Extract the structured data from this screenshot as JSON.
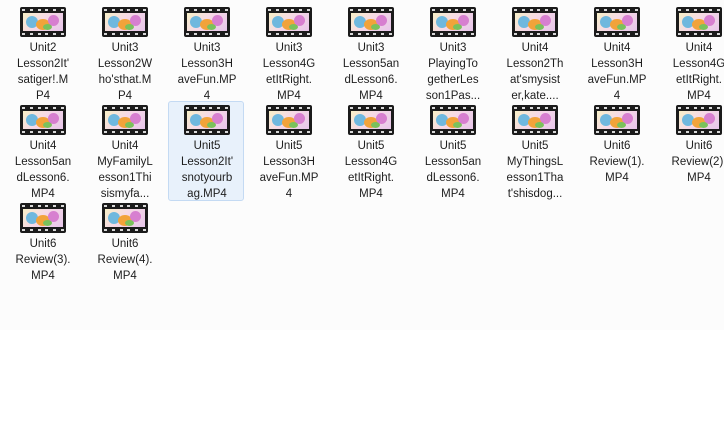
{
  "files": [
    {
      "label": "Unit2\nLesson2It'\nsatiger!.M\nP4",
      "icon": "video-file-icon"
    },
    {
      "label": "Unit3\nLesson2W\nho'sthat.M\nP4",
      "icon": "video-file-icon"
    },
    {
      "label": "Unit3\nLesson3H\naveFun.MP\n4",
      "icon": "video-file-icon"
    },
    {
      "label": "Unit3\nLesson4G\netItRight.\nMP4",
      "icon": "video-file-icon"
    },
    {
      "label": "Unit3\nLesson5an\ndLesson6.\nMP4",
      "icon": "video-file-icon"
    },
    {
      "label": "Unit3\nPlayingTo\ngetherLes\nson1Pas...",
      "icon": "video-file-icon"
    },
    {
      "label": "Unit4\nLesson2Th\nat'smysist\ner,kate....",
      "icon": "video-file-icon"
    },
    {
      "label": "Unit4\nLesson3H\naveFun.MP\n4",
      "icon": "video-file-icon"
    },
    {
      "label": "Unit4\nLesson4G\netItRight.\nMP4",
      "icon": "video-file-icon"
    },
    {
      "label": "Unit4\nLesson5an\ndLesson6.\nMP4",
      "icon": "video-file-icon"
    },
    {
      "label": "Unit4\nMyFamilyL\nesson1Thi\nsismyfa...",
      "icon": "video-file-icon"
    },
    {
      "label": "Unit5\nLesson2It'\nsnotyourb\nag.MP4",
      "icon": "video-file-icon",
      "selected": true
    },
    {
      "label": "Unit5\nLesson3H\naveFun.MP\n4",
      "icon": "video-file-icon"
    },
    {
      "label": "Unit5\nLesson4G\netItRight.\nMP4",
      "icon": "video-file-icon"
    },
    {
      "label": "Unit5\nLesson5an\ndLesson6.\nMP4",
      "icon": "video-file-icon"
    },
    {
      "label": "Unit5\nMyThingsL\nesson1Tha\nt'shisdog...",
      "icon": "video-file-icon"
    },
    {
      "label": "Unit6\nReview(1).\nMP4",
      "icon": "video-file-icon"
    },
    {
      "label": "Unit6\nReview(2).\nMP4",
      "icon": "video-file-icon"
    },
    {
      "label": "Unit6\nReview(3).\nMP4",
      "icon": "video-file-icon"
    },
    {
      "label": "Unit6\nReview(4).\nMP4",
      "icon": "video-file-icon"
    }
  ]
}
